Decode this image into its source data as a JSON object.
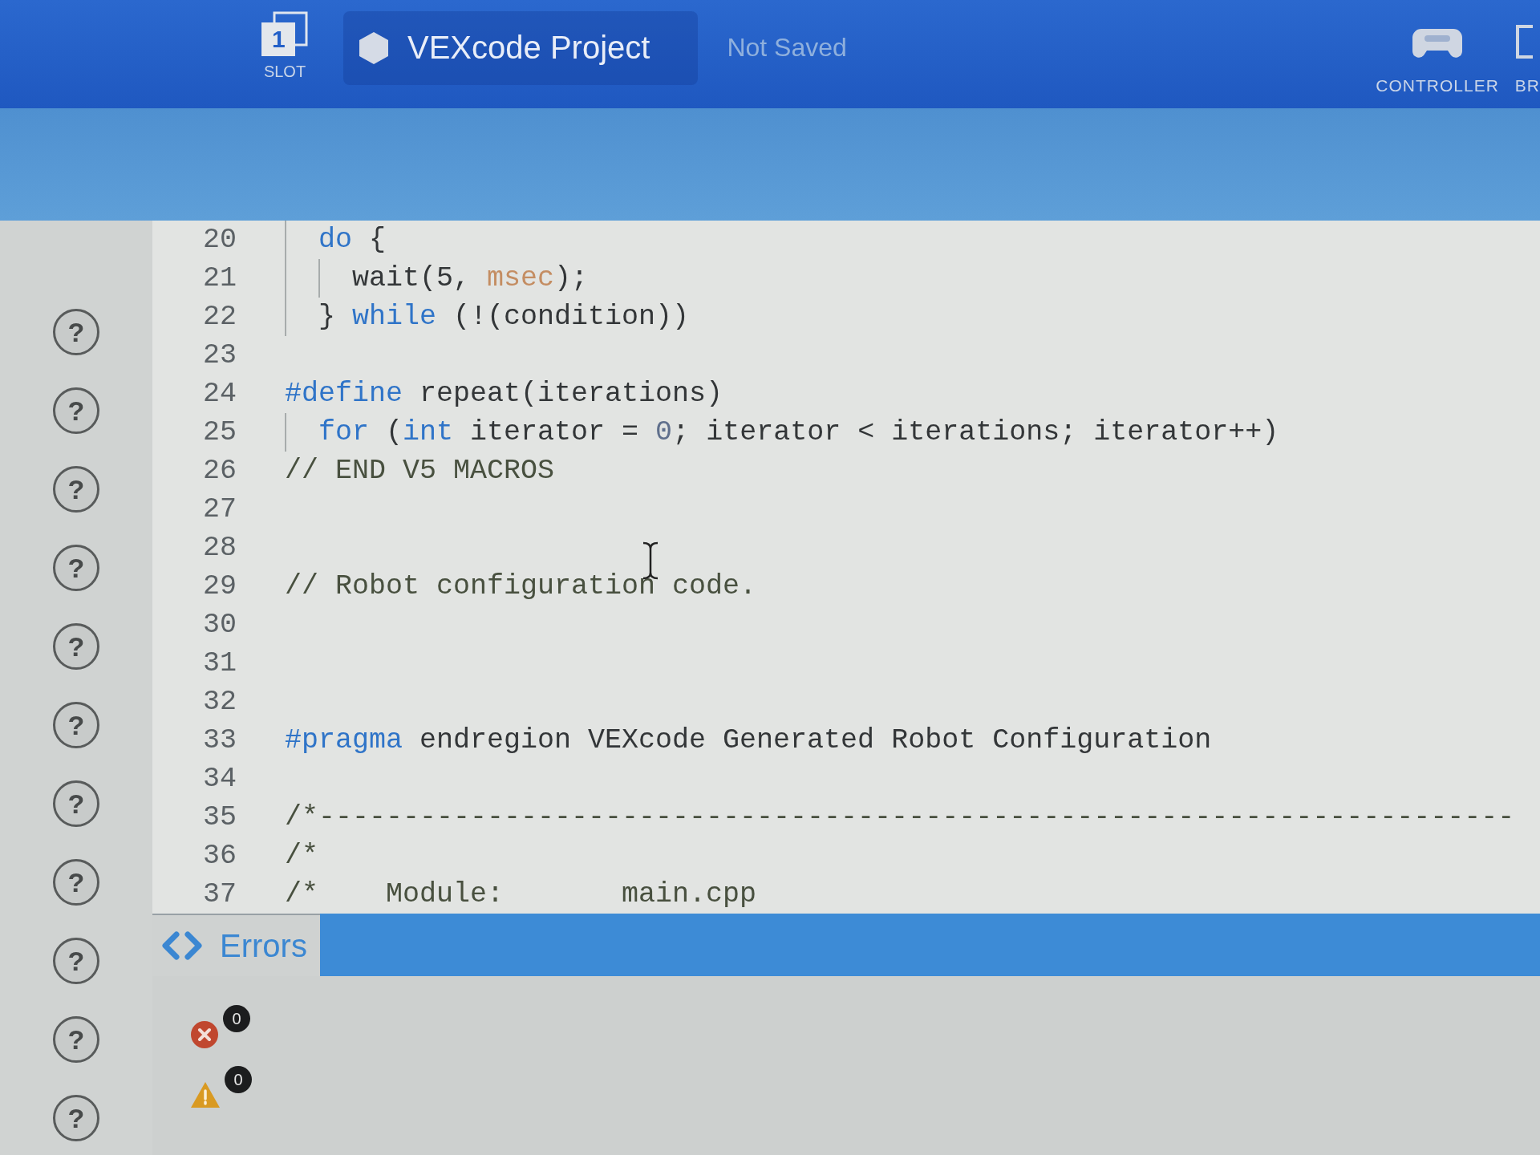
{
  "top_bar": {
    "slot": {
      "number": "1",
      "label": "SLOT"
    },
    "project": {
      "name": "VEXcode Project",
      "status": "Not Saved"
    },
    "devices": [
      {
        "kind": "controller",
        "label": "CONTROLLER"
      },
      {
        "kind": "brain",
        "label": "BR"
      }
    ]
  },
  "help_buttons": [
    "?",
    "?",
    "?",
    "?",
    "?",
    "?",
    "?",
    "?",
    "?",
    "?",
    "?"
  ],
  "editor": {
    "lines": [
      {
        "number": "20",
        "tokens": [
          {
            "text": "  do",
            "kind": "keyword"
          },
          {
            "text": " {",
            "kind": "plain"
          }
        ]
      },
      {
        "number": "21",
        "tokens": [
          {
            "text": "    wait(5, ",
            "kind": "plain"
          },
          {
            "text": "msec",
            "kind": "unit"
          },
          {
            "text": ");",
            "kind": "plain"
          }
        ]
      },
      {
        "number": "22",
        "tokens": [
          {
            "text": "  } ",
            "kind": "plain"
          },
          {
            "text": "while",
            "kind": "keyword"
          },
          {
            "text": " (!(condition))",
            "kind": "plain"
          }
        ]
      },
      {
        "number": "23"
      },
      {
        "number": "24",
        "tokens": [
          {
            "text": "#define",
            "kind": "keyword"
          },
          {
            "text": " repeat(iterations)",
            "kind": "plain"
          }
        ]
      },
      {
        "number": "25",
        "tokens": [
          {
            "text": "  for",
            "kind": "keyword"
          },
          {
            "text": " (",
            "kind": "plain"
          },
          {
            "text": "int",
            "kind": "keyword"
          },
          {
            "text": " iterator = ",
            "kind": "plain"
          },
          {
            "text": "0",
            "kind": "number"
          },
          {
            "text": "; iterator < iterations; iterator++)",
            "kind": "plain"
          }
        ]
      },
      {
        "number": "26",
        "tokens": [
          {
            "text": "// END V5 MACROS",
            "kind": "comment"
          }
        ]
      },
      {
        "number": "27"
      },
      {
        "number": "28"
      },
      {
        "number": "29",
        "tokens": [
          {
            "text": "// Robot configuration code.",
            "kind": "comment"
          }
        ]
      },
      {
        "number": "30"
      },
      {
        "number": "31"
      },
      {
        "number": "32"
      },
      {
        "number": "33",
        "tokens": [
          {
            "text": "#pragma",
            "kind": "keyword"
          },
          {
            "text": " endregion VEXcode Generated Robot Configuration",
            "kind": "plain"
          }
        ]
      },
      {
        "number": "34"
      },
      {
        "number": "35",
        "tokens": [
          {
            "text": "/*-----------------------------------------------------------------------",
            "kind": "comment"
          }
        ]
      },
      {
        "number": "36",
        "tokens": [
          {
            "text": "/*",
            "kind": "comment"
          }
        ]
      },
      {
        "number": "37",
        "tokens": [
          {
            "text": "/*    Module:       main.cpp",
            "kind": "comment"
          }
        ]
      }
    ]
  },
  "bottom_panel": {
    "tab": "Errors",
    "counts": [
      {
        "kind": "error",
        "count": "0"
      },
      {
        "kind": "warning",
        "count": "0"
      }
    ]
  }
}
